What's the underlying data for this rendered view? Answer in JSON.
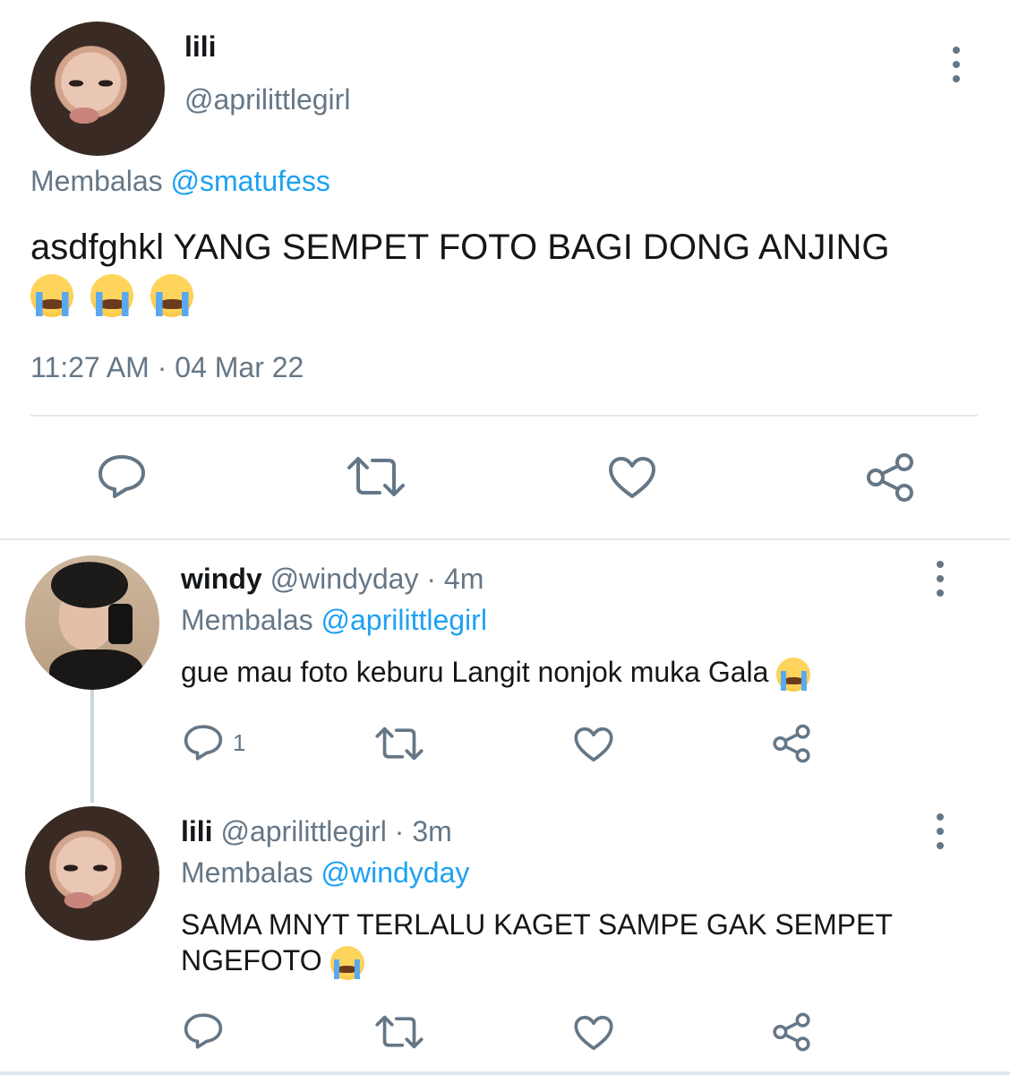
{
  "main_tweet": {
    "display_name": "lili",
    "handle": "@aprilittlegirl",
    "reply_prefix": "Membalas",
    "reply_to": "@smatufess",
    "text": "asdfghkl YANG SEMPET FOTO BAGI DONG ANJING",
    "emoji": "loudly-crying-face",
    "emoji_count": 3,
    "timestamp": "11:27 AM · 04 Mar 22"
  },
  "replies": [
    {
      "display_name": "windy",
      "handle": "@windyday",
      "age": "· 4m",
      "reply_prefix": "Membalas",
      "reply_to": "@aprilittlegirl",
      "text": "gue mau foto keburu Langit nonjok muka Gala",
      "reply_count": "1"
    },
    {
      "display_name": "lili",
      "handle": "@aprilittlegirl",
      "age": "· 3m",
      "reply_prefix": "Membalas",
      "reply_to": "@windyday",
      "text": "SAMA MNYT TERLALU KAGET SAMPE GAK SEMPET NGEFOTO",
      "reply_count": ""
    }
  ],
  "icons": [
    "reply-icon",
    "retweet-icon",
    "like-icon",
    "share-icon",
    "more-icon"
  ],
  "colors": {
    "text": "#14171a",
    "muted": "#657786",
    "link": "#1da1f2",
    "divider": "#e1e8ed"
  }
}
